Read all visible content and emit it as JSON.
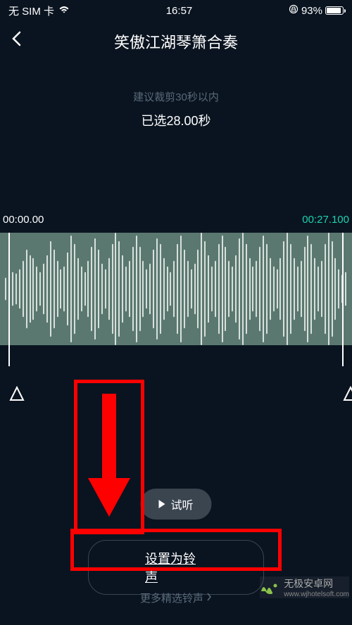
{
  "status": {
    "carrier": "无 SIM 卡",
    "time": "16:57",
    "battery_pct": "93%"
  },
  "header": {
    "title": "笑傲江湖琴箫合奏"
  },
  "editor": {
    "hint": "建议裁剪30秒以内",
    "selected_duration": "已选28.00秒",
    "time_start": "00:00.00",
    "time_end": "00:27.100"
  },
  "actions": {
    "preview": "试听",
    "set_ringtone": "设置为铃声",
    "more": "更多精选铃声"
  },
  "watermark": {
    "brand": "无极安卓网",
    "url": "www.wjhotelsoft.com"
  }
}
